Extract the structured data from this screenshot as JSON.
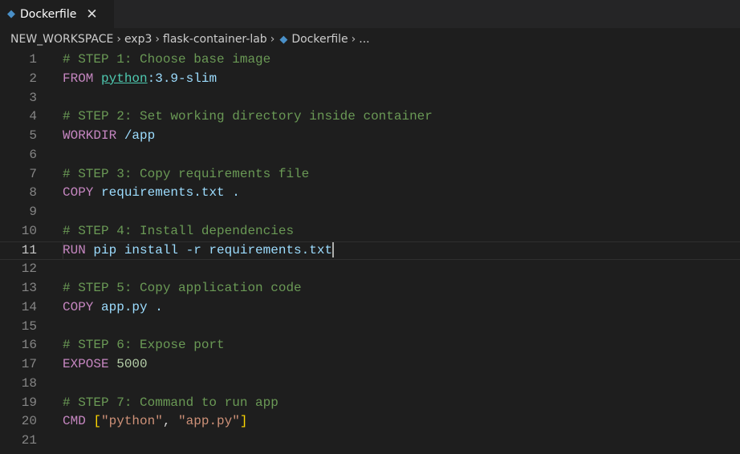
{
  "tab": {
    "title": "Dockerfile",
    "icon": "docker-whale-icon"
  },
  "breadcrumb": [
    "NEW_WORKSPACE",
    "exp3",
    "flask-container-lab",
    "Dockerfile",
    "..."
  ],
  "colors": {
    "comment": "#6a9955",
    "keyword": "#c586c0",
    "text": "#9cdcfe",
    "link": "#4ec9b0",
    "string": "#ce9178",
    "number": "#b5cea8",
    "bracket": "#ffd700",
    "plain": "#d4d4d4"
  },
  "active_line": 11,
  "lines": [
    [
      [
        "comment",
        "# STEP 1: Choose base image"
      ]
    ],
    [
      [
        "keyword",
        "FROM "
      ],
      [
        "link",
        "python"
      ],
      [
        "text",
        ":3.9-slim"
      ]
    ],
    [],
    [
      [
        "comment",
        "# STEP 2: Set working directory inside container"
      ]
    ],
    [
      [
        "keyword",
        "WORKDIR "
      ],
      [
        "text",
        "/app"
      ]
    ],
    [],
    [
      [
        "comment",
        "# STEP 3: Copy requirements file"
      ]
    ],
    [
      [
        "keyword",
        "COPY "
      ],
      [
        "text",
        "requirements.txt ."
      ]
    ],
    [],
    [
      [
        "comment",
        "# STEP 4: Install dependencies"
      ]
    ],
    [
      [
        "keyword",
        "RUN "
      ],
      [
        "text",
        "pip install -r requirements.txt"
      ]
    ],
    [],
    [
      [
        "comment",
        "# STEP 5: Copy application code"
      ]
    ],
    [
      [
        "keyword",
        "COPY "
      ],
      [
        "text",
        "app.py ."
      ]
    ],
    [],
    [
      [
        "comment",
        "# STEP 6: Expose port"
      ]
    ],
    [
      [
        "keyword",
        "EXPOSE "
      ],
      [
        "number",
        "5000"
      ]
    ],
    [],
    [
      [
        "comment",
        "# STEP 7: Command to run app"
      ]
    ],
    [
      [
        "keyword",
        "CMD "
      ],
      [
        "bracket",
        "["
      ],
      [
        "string",
        "\"python\""
      ],
      [
        "plain",
        ", "
      ],
      [
        "string",
        "\"app.py\""
      ],
      [
        "bracket",
        "]"
      ]
    ],
    []
  ]
}
